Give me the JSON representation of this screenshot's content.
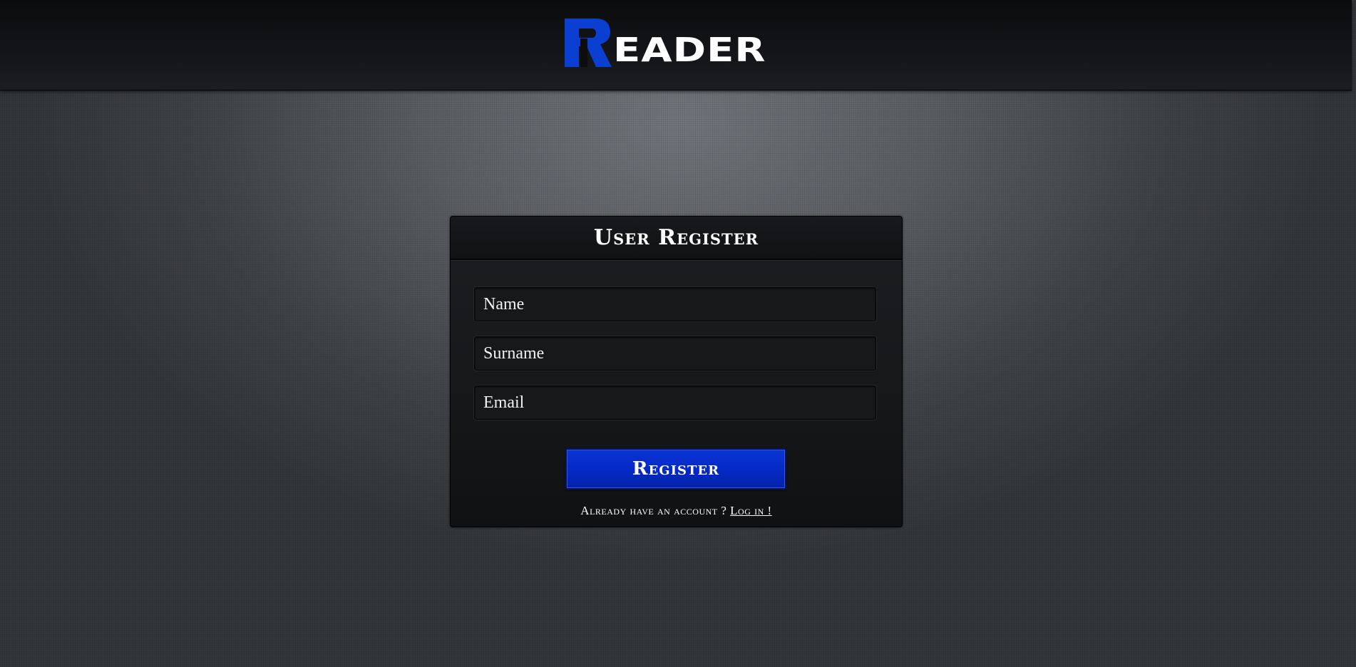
{
  "brand": {
    "logo_initial": "R",
    "logo_rest": "EADER",
    "accent_color": "#0b3fd1"
  },
  "register_form": {
    "title": "User Register",
    "fields": [
      {
        "name": "name",
        "placeholder": "Name",
        "value": ""
      },
      {
        "name": "surname",
        "placeholder": "Surname",
        "value": ""
      },
      {
        "name": "email",
        "placeholder": "Email",
        "value": ""
      }
    ],
    "submit_label": "Register",
    "footer_prompt": "Already have an account ?",
    "login_link_label": "Log in !"
  }
}
